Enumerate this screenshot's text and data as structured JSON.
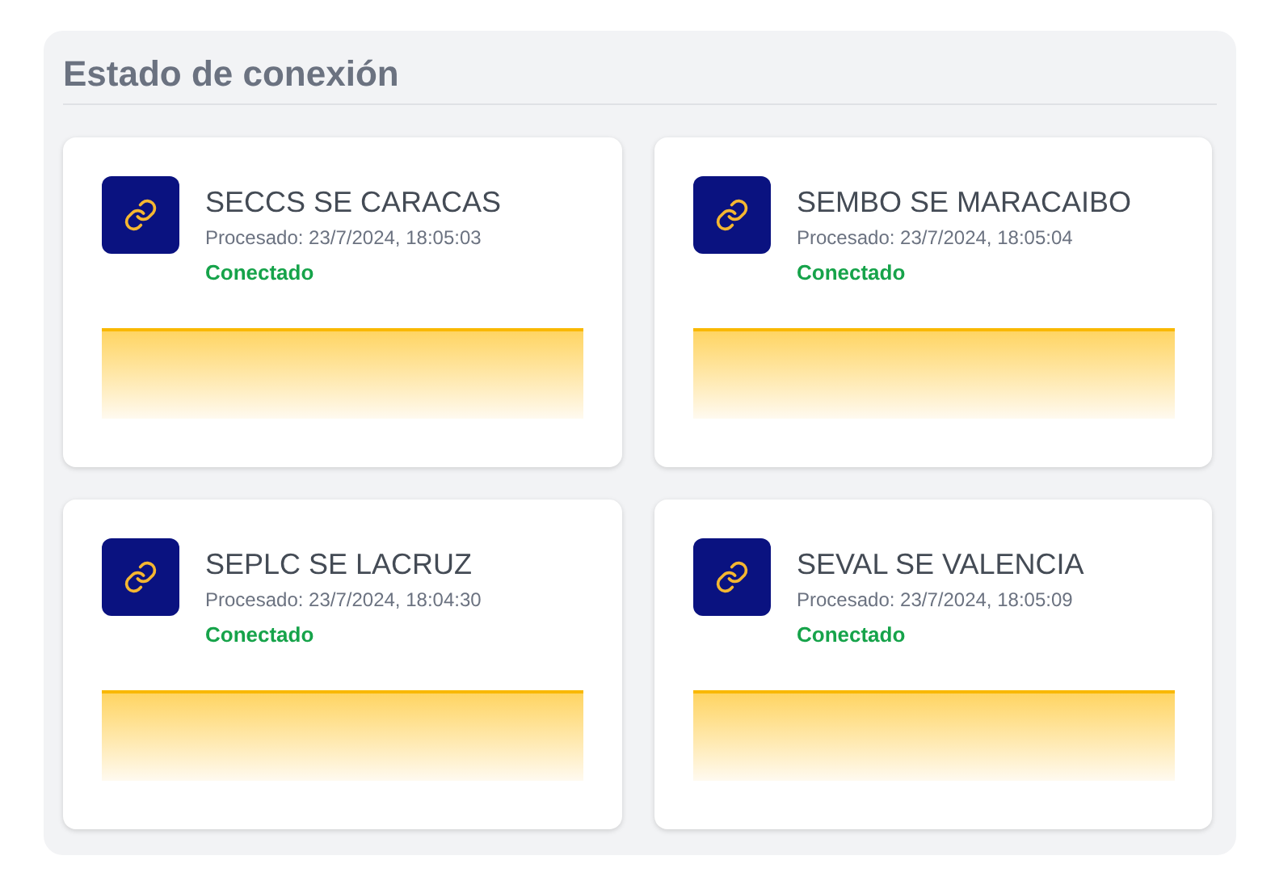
{
  "title": "Estado de conexión",
  "stations": [
    {
      "name": "SECCS SE CARACAS",
      "processed": "Procesado: 23/7/2024, 18:05:03",
      "status": "Conectado",
      "kind": "connected"
    },
    {
      "name": "SEMBO SE MARACAIBO",
      "processed": "Procesado: 23/7/2024, 18:05:04",
      "status": "Conectado",
      "kind": "connected"
    },
    {
      "name": "SEPLC SE LACRUZ",
      "processed": "Procesado: 23/7/2024, 18:04:30",
      "status": "Conectado",
      "kind": "connected"
    },
    {
      "name": "SEVAL SE VALENCIA",
      "processed": "Procesado: 23/7/2024, 18:05:09",
      "status": "Conectado",
      "kind": "connected"
    }
  ]
}
